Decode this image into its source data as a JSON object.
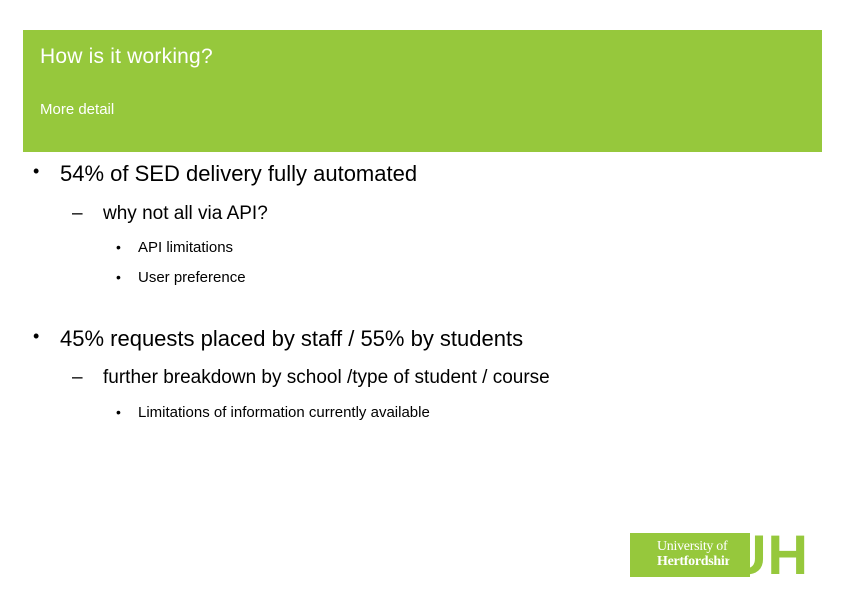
{
  "slide": {
    "title": "How is it working?",
    "subtitle": "More detail",
    "banner_color": "#96c83c",
    "background_color": "#ffffff",
    "bullets": [
      {
        "level": 1,
        "marker": "•",
        "text": "54% of SED delivery fully automated"
      },
      {
        "level": 2,
        "marker": "–",
        "text": "why not all via API?"
      },
      {
        "level": 3,
        "marker": "•",
        "text": "API limitations"
      },
      {
        "level": 3,
        "marker": "•",
        "text": "User preference"
      },
      {
        "level": 1,
        "marker": "•",
        "text": "45% requests placed by staff / 55% by students"
      },
      {
        "level": 2,
        "marker": "–",
        "text": "further breakdown by school /type of student / course"
      },
      {
        "level": 3,
        "marker": "•",
        "text": "Limitations of information currently available"
      }
    ]
  },
  "logo": {
    "word_1": "University of",
    "word_2": "Hertfordshire",
    "mark": "UH",
    "green": "#96c83c"
  }
}
